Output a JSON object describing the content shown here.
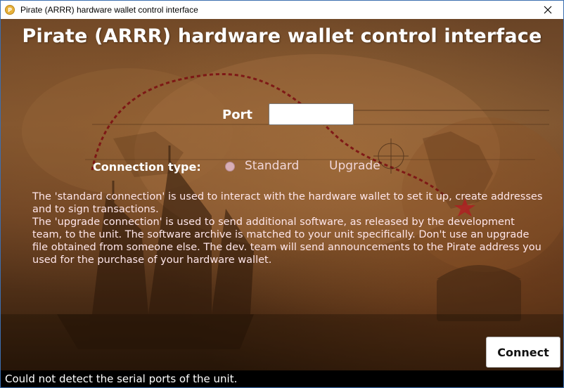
{
  "window": {
    "title": "Pirate (ARRR) hardware wallet control interface",
    "app_icon_glyph": "P"
  },
  "header": {
    "title": "Pirate (ARRR) hardware wallet control interface"
  },
  "form": {
    "port_label": "Port",
    "port_value": "",
    "connection_type_label": "Connection type:",
    "options": [
      "Standard",
      "Upgrade"
    ],
    "selected_option": "Standard",
    "description": [
      "The 'standard connection' is used to interact with the hardware wallet to set it up, create addresses and to sign transactions.",
      "The 'upgrade connection' is used to send additional software, as released by the development team, to the unit. The software archive is matched to your unit specifically. Don't use an upgrade file obtained from someone else. The dev. team will send announcements to the Pirate address you used for the purchase of your hardware wallet."
    ],
    "connect_label": "Connect"
  },
  "status": {
    "message": "Could not detect the serial ports of the unit."
  },
  "colors": {
    "title_text": "#ffffff",
    "description_text": "#ffe6ea",
    "radio_selected": "#d8aeb6",
    "statusbar_bg": "#000000"
  },
  "icons": {
    "app": "pirate-coin-icon",
    "close": "close-icon",
    "radio": "radio-icon"
  }
}
